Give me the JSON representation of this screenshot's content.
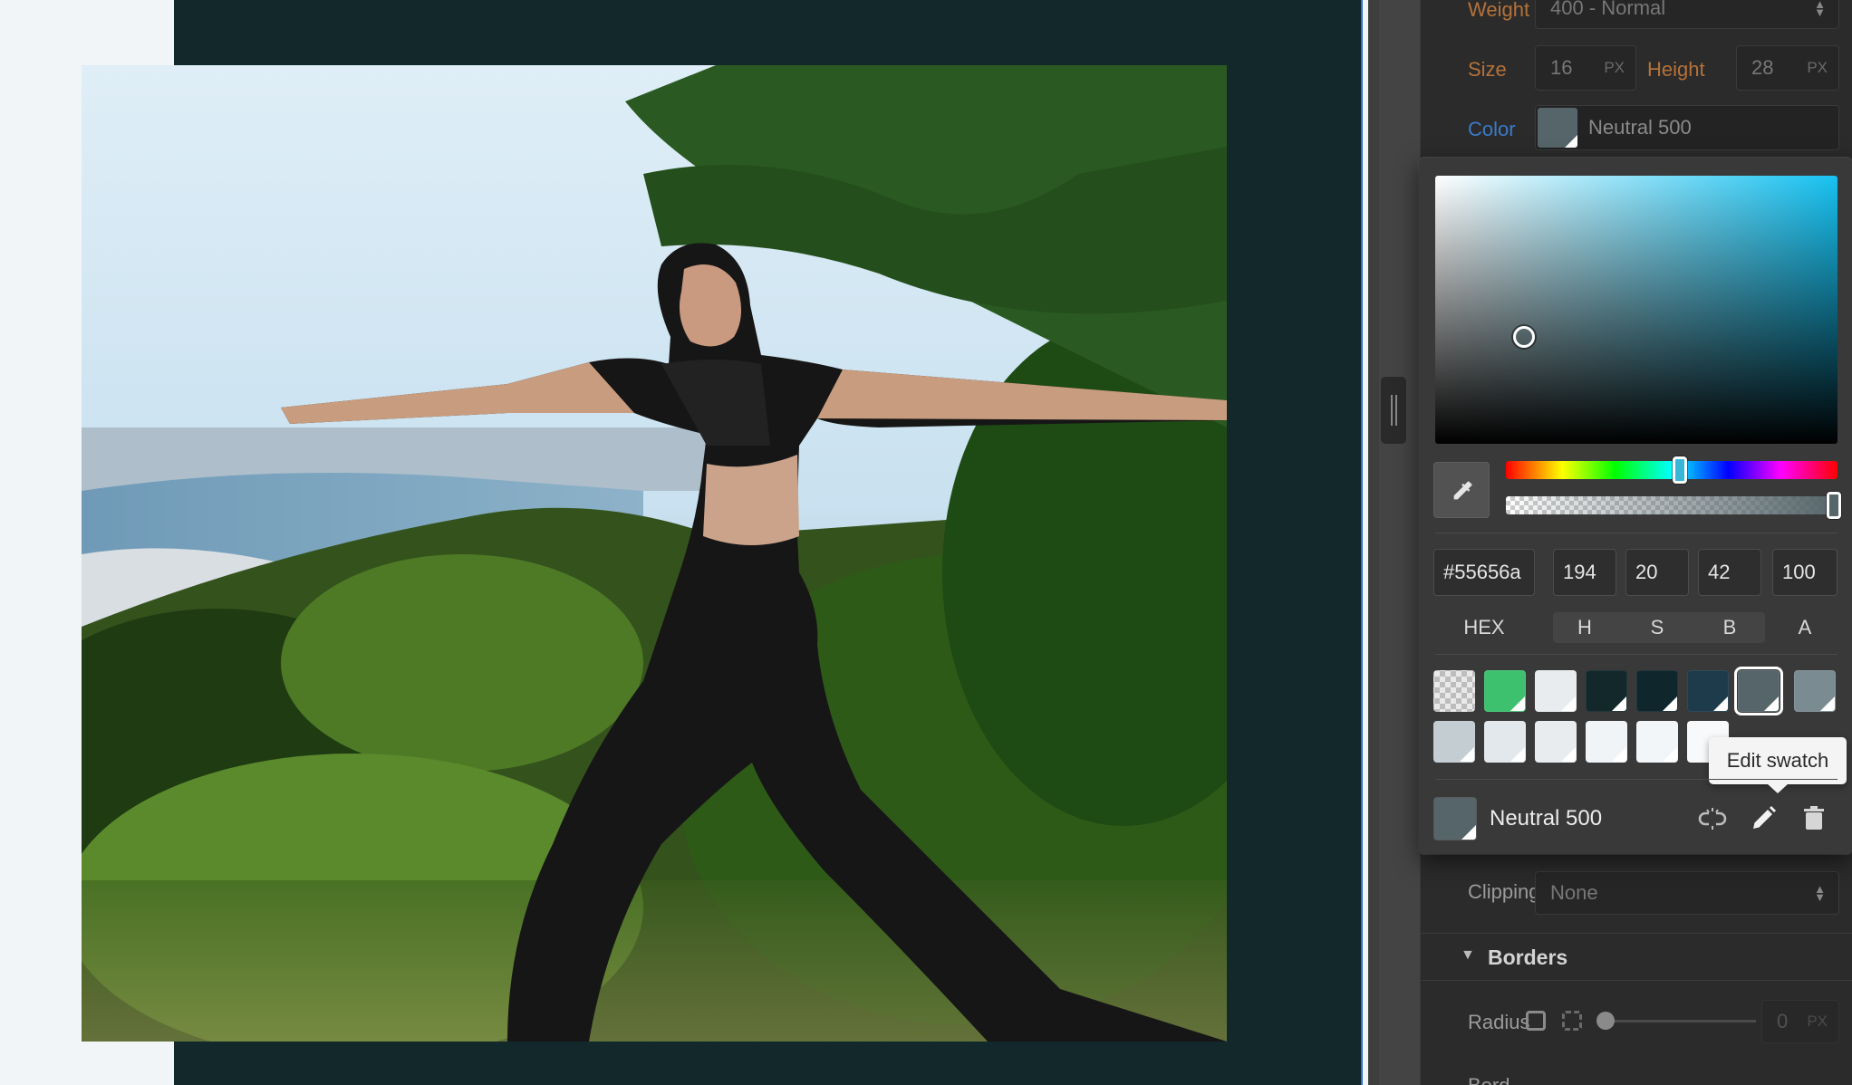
{
  "typography": {
    "weight_label": "Weight",
    "weight_value": "400 - Normal",
    "size_label": "Size",
    "size_value": "16",
    "size_unit": "PX",
    "height_label": "Height",
    "height_value": "28",
    "height_unit": "PX",
    "color_label": "Color",
    "color_name": "Neutral 500",
    "color_hex": "#55656a"
  },
  "color_picker": {
    "hex": "#55656a",
    "h": "194",
    "s": "20",
    "b": "42",
    "a": "100",
    "labels": {
      "hex": "HEX",
      "h": "H",
      "s": "S",
      "b": "B",
      "a": "A"
    },
    "hue_fraction": 0.54,
    "alpha_percent": 100,
    "swatches_row1": [
      "transparent",
      "#3ec16e",
      "#e9ecee",
      "#12282a",
      "#0f262d",
      "#1e3b4c",
      "#55656a",
      "#7a8b91"
    ],
    "swatches_row2": [
      "#c3cdd2",
      "#e3e8ec",
      "#e8ecef",
      "#f1f4f6",
      "#f3f6f8",
      "#f7f9fa"
    ],
    "selected_swatch_index": 6,
    "tooltip": "Edit swatch",
    "current_swatch_name": "Neutral 500",
    "action_icons": [
      "unlink-icon",
      "pencil-icon",
      "trash-icon"
    ]
  },
  "background": {
    "clipping_label": "Clipping",
    "clipping_value": "None"
  },
  "borders": {
    "section_title": "Borders",
    "radius_label": "Radius",
    "radius_value": "0",
    "radius_unit": "PX",
    "next_label": "Bord"
  },
  "canvas": {
    "dark_bg": "#12282a",
    "light_bg": "#f1f5f8",
    "accent": "#2d6fd6"
  }
}
